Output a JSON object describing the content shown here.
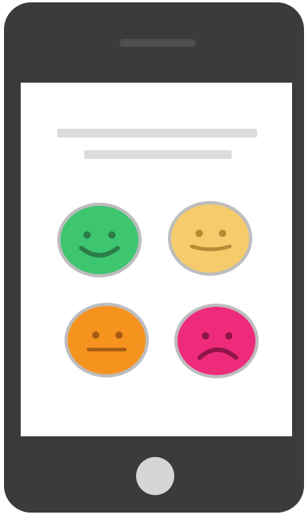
{
  "illustration": {
    "device": "smartphone",
    "colors": {
      "body": "#3b3b3d",
      "screen": "#ffffff",
      "placeholder_lines": "#dcdcdc",
      "home_button": "#d6d6d6"
    },
    "rating_faces": [
      {
        "icon": "happy-face-icon",
        "color": "#3ec56f"
      },
      {
        "icon": "content-face-icon",
        "color": "#f6cb6b"
      },
      {
        "icon": "neutral-face-icon",
        "color": "#f6931e"
      },
      {
        "icon": "sad-face-icon",
        "color": "#ee2a7b"
      }
    ]
  }
}
